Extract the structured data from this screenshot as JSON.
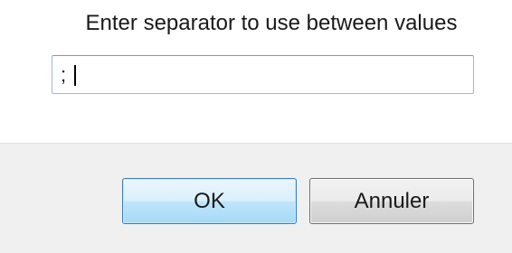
{
  "dialog": {
    "prompt": "Enter separator to use between values",
    "input": {
      "value": ";",
      "placeholder": ""
    },
    "buttons": {
      "ok_label": "OK",
      "cancel_label": "Annuler"
    }
  }
}
